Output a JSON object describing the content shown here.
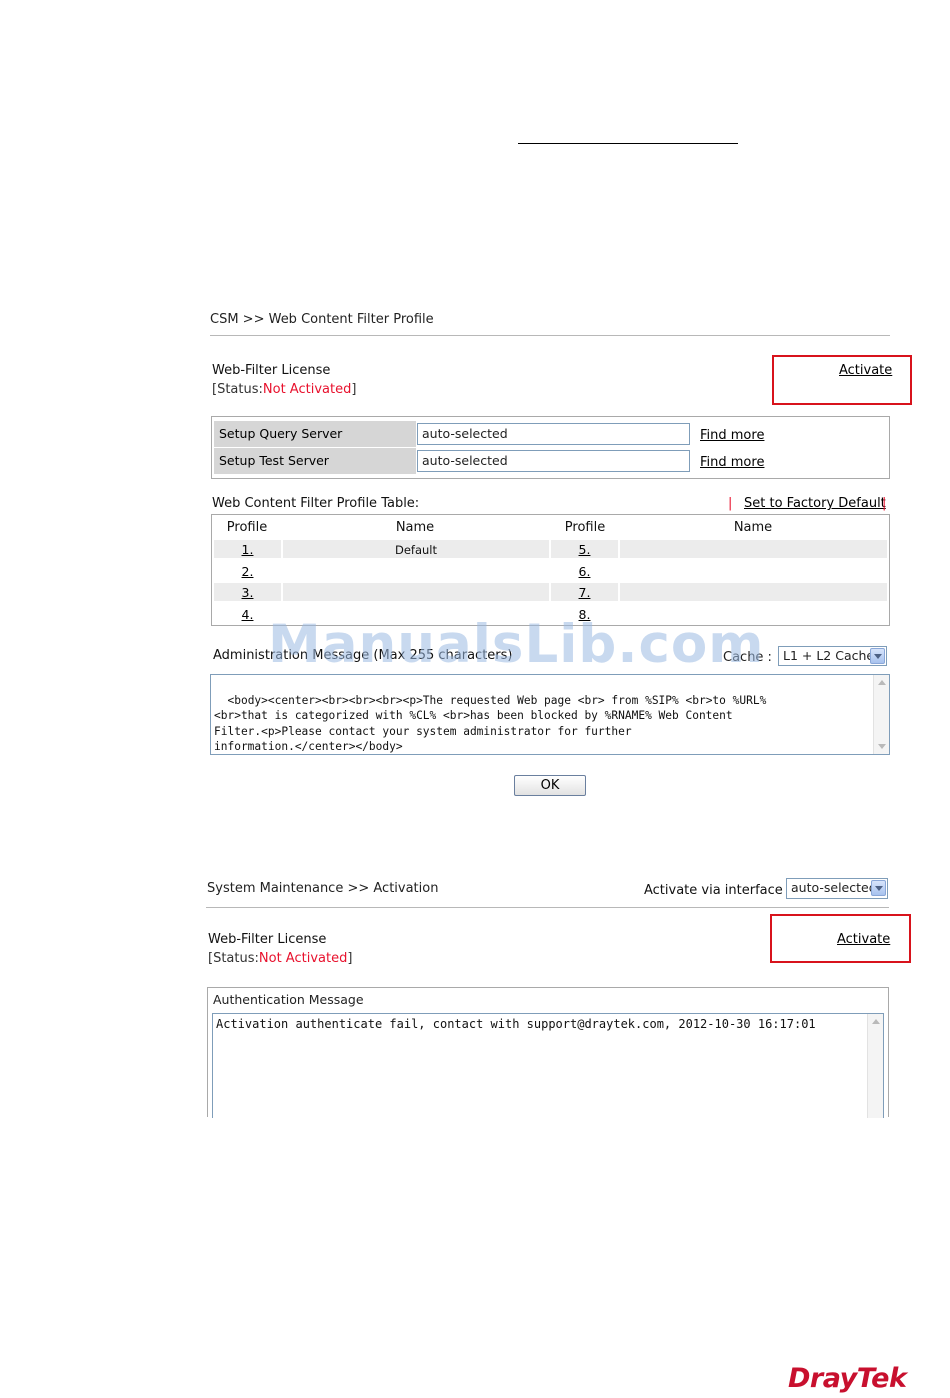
{
  "panel1": {
    "breadcrumb": "CSM >> Web Content Filter Profile",
    "license_title": "Web-Filter License",
    "status_open": "[Status:",
    "status_value": "Not Activated",
    "status_close": "]",
    "activate_label": "Activate",
    "setup": {
      "query_label": "Setup Query Server",
      "query_value": "auto-selected",
      "test_label": "Setup Test Server",
      "test_value": "auto-selected",
      "find_more": "Find more"
    },
    "table_title": "Web Content Filter Profile Table:",
    "factory_sep_left": "|",
    "factory_default": "Set to Factory Default",
    "factory_sep_right": "|",
    "columns": {
      "profile": "Profile",
      "name": "Name"
    },
    "rows": [
      {
        "left_num": "1.",
        "left_name": "Default",
        "right_num": "5.",
        "right_name": ""
      },
      {
        "left_num": "2.",
        "left_name": "",
        "right_num": "6.",
        "right_name": ""
      },
      {
        "left_num": "3.",
        "left_name": "",
        "right_num": "7.",
        "right_name": ""
      },
      {
        "left_num": "4.",
        "left_name": "",
        "right_num": "8.",
        "right_name": ""
      }
    ],
    "admin_label": "Administration Message (Max 255 characters)",
    "cache_label": "Cache :",
    "cache_value": "L1 + L2 Cache",
    "admin_message": "<body><center><br><br><br><p>The requested Web page <br> from %SIP% <br>to %URL%\n<br>that is categorized with %CL% <br>has been blocked by %RNAME% Web Content\nFilter.<p>Please contact your system administrator for further\ninformation.</center></body>",
    "ok_label": "OK"
  },
  "watermark": "ManualsLib.com",
  "panel2": {
    "breadcrumb": "System Maintenance >> Activation",
    "activate_via_label": "Activate via interface :",
    "activate_via_value": "auto-selected",
    "license_title": "Web-Filter License",
    "status_open": "[Status:",
    "status_value": "Not Activated",
    "status_close": "]",
    "activate_label": "Activate",
    "auth_title": "Authentication Message",
    "auth_message": "Activation authenticate fail, contact with support@draytek.com, 2012-10-30 16:17:01"
  },
  "logo": "DrayTek",
  "colors": {
    "status_red": "#e8112d",
    "highlight_red": "#d8131c",
    "logo_red": "#c8102e"
  }
}
